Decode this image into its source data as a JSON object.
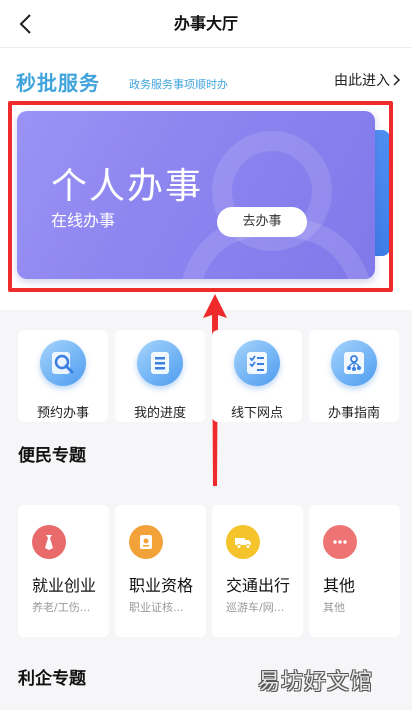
{
  "header": {
    "title": "办事大厅"
  },
  "seckill": {
    "title": "秒批服务",
    "subtitle": "政务服务事项顺时办",
    "enter_label": "由此进入"
  },
  "banner": {
    "title": "个人办事",
    "subtitle": "在线办事",
    "button_label": "去办事"
  },
  "quick_actions": [
    {
      "label": "预约办事",
      "icon": "search-icon"
    },
    {
      "label": "我的进度",
      "icon": "list-icon"
    },
    {
      "label": "线下网点",
      "icon": "checklist-icon"
    },
    {
      "label": "办事指南",
      "icon": "guide-icon"
    }
  ],
  "convenience": {
    "title": "便民专题",
    "cards": [
      {
        "title": "就业创业",
        "desc": "养老/工伤...",
        "icon": "tie-icon",
        "color": "#e96a6a"
      },
      {
        "title": "职业资格",
        "desc": "职业证核...",
        "icon": "certificate-icon",
        "color": "#f3a23a"
      },
      {
        "title": "交通出行",
        "desc": "巡游车/网...",
        "icon": "truck-icon",
        "color": "#f5c32a"
      },
      {
        "title": "其他",
        "desc": "其他",
        "icon": "more-icon",
        "color": "#ee7474"
      }
    ]
  },
  "enterprise": {
    "title": "利企专题"
  },
  "watermark": "易坊好文馆",
  "colors": {
    "accent": "#3fa4dc",
    "banner": "#8c84ef",
    "highlight": "#ef2b2b"
  }
}
